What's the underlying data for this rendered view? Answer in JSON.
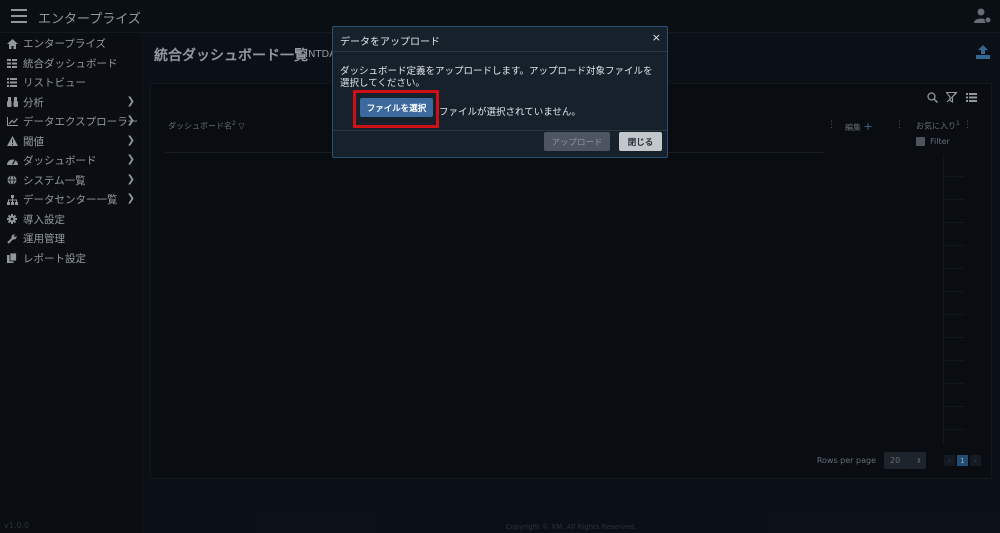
{
  "app": {
    "title": "エンタープライズ",
    "version": "v1.0.0"
  },
  "sidebar": {
    "items": [
      {
        "label": "エンタープライズ",
        "icon": "home-icon",
        "has_submenu": false
      },
      {
        "label": "統合ダッシュボード",
        "icon": "grid-icon",
        "has_submenu": false
      },
      {
        "label": "リストビュー",
        "icon": "list-icon",
        "has_submenu": false
      },
      {
        "label": "分析",
        "icon": "binoculars-icon",
        "has_submenu": true
      },
      {
        "label": "データエクスプローラー",
        "icon": "line-chart-icon",
        "has_submenu": true
      },
      {
        "label": "閾値",
        "icon": "warning-icon",
        "has_submenu": true
      },
      {
        "label": "ダッシュボード",
        "icon": "gauge-icon",
        "has_submenu": true
      },
      {
        "label": "システム一覧",
        "icon": "globe-icon",
        "has_submenu": true
      },
      {
        "label": "データセンター一覧",
        "icon": "sitemap-icon",
        "has_submenu": true
      },
      {
        "label": "導入設定",
        "icon": "gear-icon",
        "has_submenu": false
      },
      {
        "label": "運用管理",
        "icon": "wrench-icon",
        "has_submenu": false
      },
      {
        "label": "レポート設定",
        "icon": "copy-icon",
        "has_submenu": false
      }
    ]
  },
  "main": {
    "title": "統合ダッシュボード一覧",
    "code": "INTDA"
  },
  "grid": {
    "columns": [
      {
        "label": "ダッシュボード名",
        "sort_order": "2"
      },
      {
        "label": "編集"
      },
      {
        "label": "お気に入り",
        "sort_order": "1"
      }
    ],
    "filter_label": "Filter",
    "rows_per_page_label": "Rows per page",
    "rows_per_page": "20",
    "current_page": "1"
  },
  "footer": {
    "copyright": "Copyright © XM. All Rights Reserved."
  },
  "modal": {
    "title": "データをアップロード",
    "close_glyph": "×",
    "message": "ダッシュボード定義をアップロードします。アップロード対象ファイルを選択してください。",
    "choose_file_label": "ファイルを選択",
    "no_file_text": "ファイルが選択されていません。",
    "upload_label": "アップロード",
    "close_label": "閉じる"
  },
  "colors": {
    "background": "#0c1118",
    "accent": "#3d6a9e",
    "highlight": "#cc1016"
  }
}
